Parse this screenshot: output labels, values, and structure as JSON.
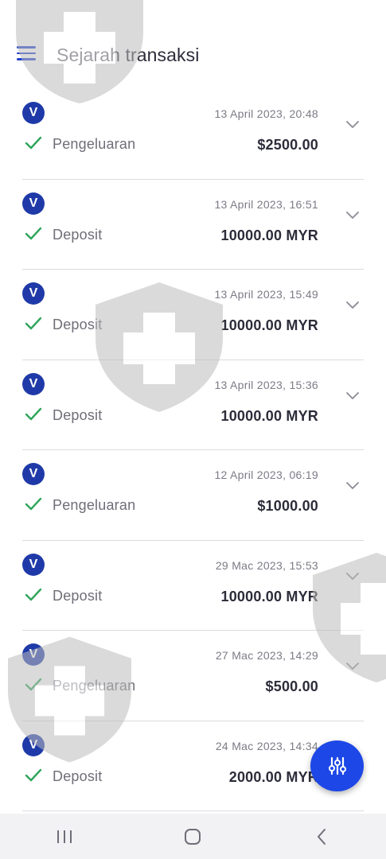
{
  "header": {
    "title": "Sejarah transaksi",
    "menu_icon": "hamburger-menu-icon"
  },
  "colors": {
    "accent": "#1d47e6",
    "badge": "#1f3aa8",
    "success": "#2fa55a"
  },
  "transactions": [
    {
      "badge": "V",
      "datetime": "13 April 2023, 20:48",
      "type": "Pengeluaran",
      "amount": "$2500.00"
    },
    {
      "badge": "V",
      "datetime": "13 April 2023, 16:51",
      "type": "Deposit",
      "amount": "10000.00 MYR"
    },
    {
      "badge": "V",
      "datetime": "13 April 2023, 15:49",
      "type": "Deposit",
      "amount": "10000.00 MYR"
    },
    {
      "badge": "V",
      "datetime": "13 April 2023, 15:36",
      "type": "Deposit",
      "amount": "10000.00 MYR"
    },
    {
      "badge": "V",
      "datetime": "12 April 2023, 06:19",
      "type": "Pengeluaran",
      "amount": "$1000.00"
    },
    {
      "badge": "V",
      "datetime": "29 Mac 2023, 15:53",
      "type": "Deposit",
      "amount": "10000.00 MYR"
    },
    {
      "badge": "V",
      "datetime": "27 Mac 2023, 14:29",
      "type": "Pengeluaran",
      "amount": "$500.00"
    },
    {
      "badge": "V",
      "datetime": "24 Mac 2023, 14:34",
      "type": "Deposit",
      "amount": "2000.00 MYR"
    }
  ],
  "fab": {
    "icon": "filter-sliders-icon"
  },
  "navbar": {
    "icons": [
      "recent-apps-icon",
      "home-icon",
      "back-icon"
    ]
  }
}
